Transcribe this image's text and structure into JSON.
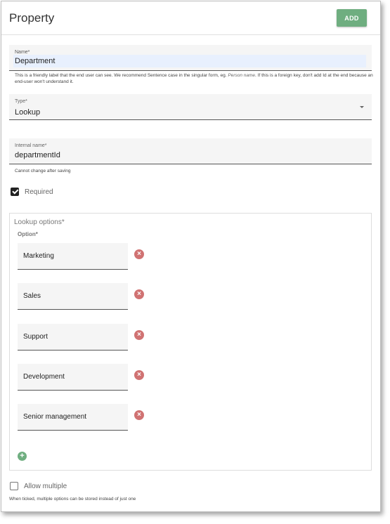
{
  "dialog": {
    "title": "Property",
    "add_label": "ADD"
  },
  "name_field": {
    "label": "Name*",
    "value": "Department",
    "helper_prefix": "This is a friendly label that the end user can see. We recommend Sentence case in the singular form, eg. ",
    "helper_example": "Person name",
    "helper_suffix": ". If this is a foreign key, don't add Id at the end because an end-user won't understand it."
  },
  "type_field": {
    "label": "Type*",
    "value": "Lookup"
  },
  "internal_field": {
    "label": "Internal name*",
    "value": "departmentId",
    "helper": "Cannot change after saving"
  },
  "required": {
    "label": "Required",
    "checked": true
  },
  "lookup": {
    "title": "Lookup options*",
    "option_header": "Option*",
    "options": [
      "Marketing",
      "Sales",
      "Support",
      "Development",
      "Senior management"
    ],
    "remove_icon": "close-circle-icon",
    "add_icon": "plus-circle-icon"
  },
  "allow_multiple": {
    "label": "Allow multiple",
    "checked": false,
    "helper": "When ticked, multiple options can be stored instead of just one"
  },
  "colors": {
    "accent_green": "#6fae80",
    "remove_red": "#d07272",
    "autofill_blue": "#e8f0fe"
  }
}
